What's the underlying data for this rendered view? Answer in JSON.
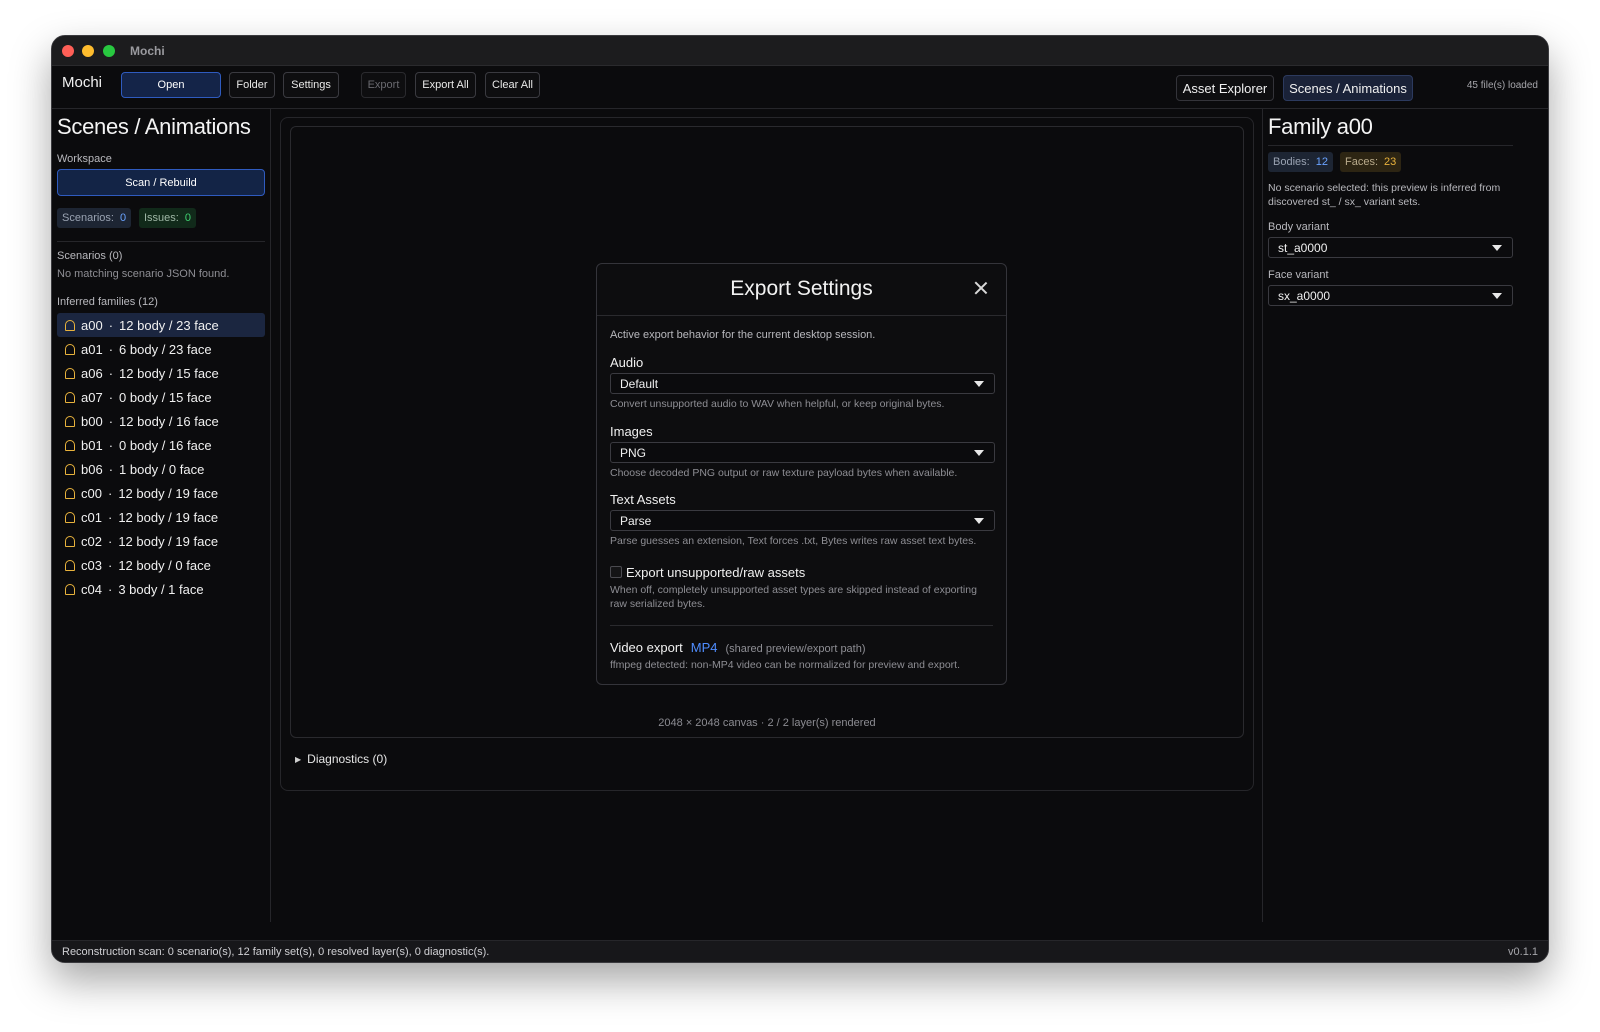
{
  "window": {
    "title": "Mochi"
  },
  "toolbar": {
    "brand": "Mochi",
    "open": "Open",
    "folder": "Folder",
    "settings": "Settings",
    "export": "Export",
    "export_all": "Export All",
    "clear_all": "Clear All",
    "tab_asset_explorer": "Asset Explorer",
    "tab_scenes": "Scenes / Animations",
    "files_loaded": "45 file(s) loaded"
  },
  "left": {
    "title": "Scenes / Animations",
    "workspace_label": "Workspace",
    "scan_button": "Scan / Rebuild",
    "scenarios_chip": {
      "label": "Scenarios:",
      "value": "0"
    },
    "issues_chip": {
      "label": "Issues:",
      "value": "0"
    },
    "scenarios_heading": "Scenarios (0)",
    "scenarios_empty": "No matching scenario JSON found.",
    "families_heading": "Inferred families (12)",
    "families": [
      {
        "id": "a00",
        "detail": "12 body / 23 face"
      },
      {
        "id": "a01",
        "detail": "6 body / 23 face"
      },
      {
        "id": "a06",
        "detail": "12 body / 15 face"
      },
      {
        "id": "a07",
        "detail": "0 body / 15 face"
      },
      {
        "id": "b00",
        "detail": "12 body / 16 face"
      },
      {
        "id": "b01",
        "detail": "0 body / 16 face"
      },
      {
        "id": "b06",
        "detail": "1 body / 0 face"
      },
      {
        "id": "c00",
        "detail": "12 body / 19 face"
      },
      {
        "id": "c01",
        "detail": "12 body / 19 face"
      },
      {
        "id": "c02",
        "detail": "12 body / 19 face"
      },
      {
        "id": "c03",
        "detail": "12 body / 0 face"
      },
      {
        "id": "c04",
        "detail": "3 body / 1 face"
      }
    ],
    "separator": "·"
  },
  "center": {
    "canvas_info": "2048 × 2048 canvas · 2 / 2 layer(s) rendered",
    "diagnostics": "Diagnostics (0)"
  },
  "modal": {
    "title": "Export Settings",
    "intro": "Active export behavior for the current desktop session.",
    "audio_label": "Audio",
    "audio_value": "Default",
    "audio_hint": "Convert unsupported audio to WAV when helpful, or keep original bytes.",
    "images_label": "Images",
    "images_value": "PNG",
    "images_hint": "Choose decoded PNG output or raw texture payload bytes when available.",
    "text_label": "Text Assets",
    "text_value": "Parse",
    "text_hint": "Parse guesses an extension, Text forces .txt, Bytes writes raw asset text bytes.",
    "raw_label": "Export unsupported/raw assets",
    "raw_hint": "When off, completely unsupported asset types are skipped instead of exporting raw serialized bytes.",
    "video_label": "Video export",
    "video_format": "MP4",
    "video_note": "(shared preview/export path)",
    "video_hint": "ffmpeg detected: non-MP4 video can be normalized for preview and export."
  },
  "right": {
    "title": "Family a00",
    "bodies_chip": {
      "label": "Bodies:",
      "value": "12"
    },
    "faces_chip": {
      "label": "Faces:",
      "value": "23"
    },
    "hint": "No scenario selected: this preview is inferred from discovered st_ / sx_ variant sets.",
    "body_label": "Body variant",
    "body_value": "st_a0000",
    "face_label": "Face variant",
    "face_value": "sx_a0000"
  },
  "status": {
    "text": "Reconstruction scan: 0 scenario(s), 12 family set(s), 0 resolved layer(s), 0 diagnostic(s).",
    "version": "v0.1.1"
  },
  "colors": {
    "accent": "#2f5bbf",
    "family_icon": "#e8b23c",
    "video_format": "#4f8dff"
  }
}
